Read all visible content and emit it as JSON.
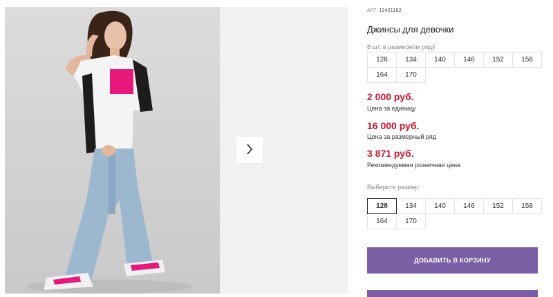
{
  "product": {
    "sku_label": "АРТ.",
    "sku_value": "12421182",
    "title": "Джинсы для девочки"
  },
  "size_row": {
    "hint": "8 шт. в размерном ряду",
    "sizes": [
      "128",
      "134",
      "140",
      "146",
      "152",
      "158",
      "164",
      "170"
    ]
  },
  "prices": {
    "unit_price": "2 000 руб.",
    "unit_label": "Цена за единицу",
    "row_price": "16 000 руб.",
    "row_label": "Цена за размерный ряд",
    "retail_price": "3 871 руб.",
    "retail_label": "Рекомендуемая розничная цена"
  },
  "size_select": {
    "hint": "Выберите размер:",
    "selected": "128",
    "sizes": [
      "128",
      "134",
      "140",
      "146",
      "152",
      "158",
      "164",
      "170"
    ]
  },
  "actions": {
    "add_to_cart": "ДОБАВИТЬ В КОРЗИНУ"
  },
  "colors": {
    "price": "#d3122c",
    "button": "#7b5fa4"
  },
  "icons": {
    "next": "chevron-right-icon"
  }
}
